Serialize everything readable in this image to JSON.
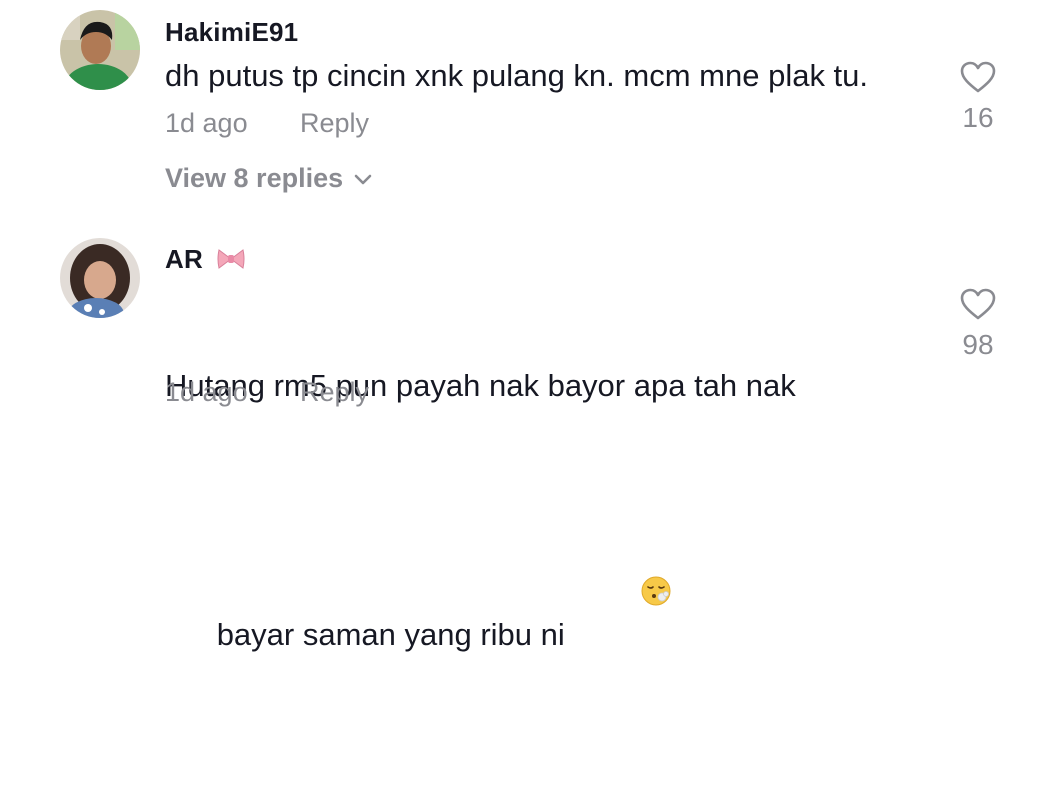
{
  "comments": [
    {
      "username": "HakimiE91",
      "text": "dh putus tp cincin xnk pulang kn. mcm mne plak tu.",
      "time": "1d ago",
      "reply_label": "Reply",
      "likes": "16",
      "view_replies": "View 8 replies"
    },
    {
      "username": "AR",
      "text_line1": "Hutang rm5 pun payah nak bayor apa tah nak",
      "text_line2": "bayar saman yang ribu ni",
      "time": "1d ago",
      "reply_label": "Reply",
      "likes": "98"
    }
  ],
  "colors": {
    "text": "#161823",
    "secondary": "#8a8b91",
    "bow": "#f4a7b9"
  },
  "icons": [
    "heart-outline-icon",
    "chevron-down-icon",
    "bow-emoji-icon",
    "face-exhaling-emoji-icon"
  ]
}
